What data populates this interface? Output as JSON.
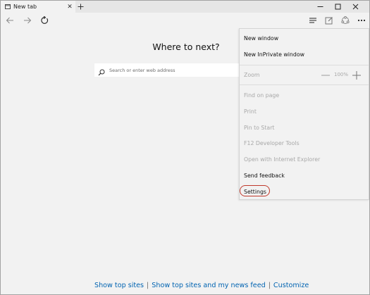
{
  "tab": {
    "title": "New tab"
  },
  "main": {
    "heading": "Where to next?",
    "search_placeholder": "Search or enter web address"
  },
  "menu": {
    "new_window": "New window",
    "new_inprivate_window": "New InPrivate window",
    "zoom_label": "Zoom",
    "zoom_value": "100%",
    "find_on_page": "Find on page",
    "print": "Print",
    "pin_to_start": "Pin to Start",
    "f12_tools": "F12 Developer Tools",
    "open_with_ie": "Open with Internet Explorer",
    "send_feedback": "Send feedback",
    "settings": "Settings"
  },
  "footer": {
    "link1": "Show top sites",
    "link2": "Show top sites and my news feed",
    "link3": "Customize",
    "separator": "|"
  },
  "colors": {
    "background": "#f2f2f2",
    "link": "#0063b1",
    "highlight_ring": "#c0392b",
    "disabled_text": "#a8a8a8"
  },
  "icons": {
    "tab_favicon": "page-icon",
    "back": "arrow-left-icon",
    "forward": "arrow-right-icon",
    "refresh": "refresh-icon",
    "hub": "hub-icon",
    "web_note": "web-note-icon",
    "share": "share-icon",
    "more": "more-icon"
  }
}
